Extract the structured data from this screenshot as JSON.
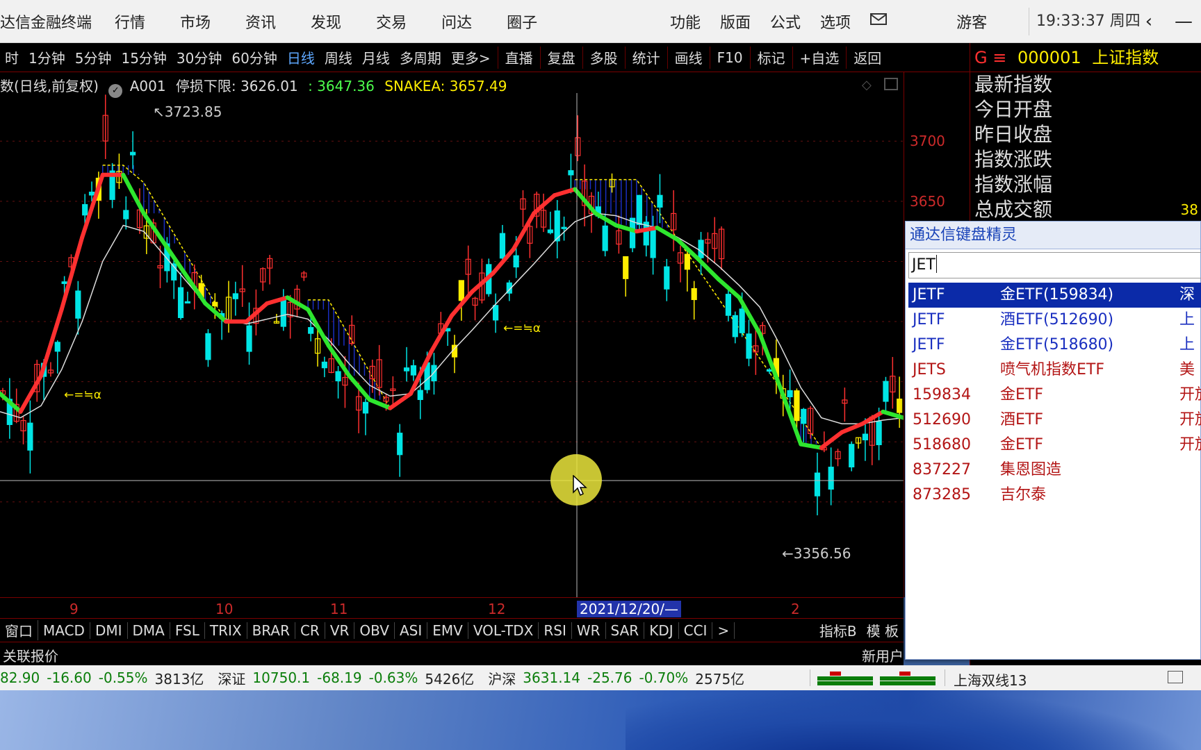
{
  "titlebar": {
    "app_title": "达信金融终端",
    "menus": [
      "行情",
      "市场",
      "资讯",
      "发现",
      "交易",
      "问达",
      "圈子"
    ],
    "right_menus": [
      "功能",
      "版面",
      "公式",
      "选项"
    ],
    "mail_icon": "mail-icon",
    "user": "游客",
    "clock": "19:33:37 周四"
  },
  "toolbar": {
    "items": [
      "时",
      "1分钟",
      "5分钟",
      "15分钟",
      "30分钟",
      "60分钟",
      "日线",
      "周线",
      "月线",
      "多周期",
      "更多>"
    ],
    "active": "日线",
    "right_items": [
      "直播",
      "复盘",
      "多股",
      "统计",
      "画线",
      "F10",
      "标记",
      "+自选",
      "返回"
    ]
  },
  "chart_info": {
    "name": "数(日线,前复权)",
    "a001": "A001",
    "stop_label": "停损下限: 3626.01",
    "v1": ": 3647.36",
    "v2": "SNAKEA: 3657.49"
  },
  "chart_data": {
    "type": "line",
    "title": "",
    "ylabel": "",
    "ylim": [
      3330,
      3740
    ],
    "y_ticks": [
      3650,
      3700
    ],
    "x_ticks": [
      "9",
      "10",
      "11",
      "12",
      "2"
    ],
    "crosshair_date": "2021/12/20/—",
    "high_label": "3723.85",
    "low_label": "3356.56",
    "annotation": "←=≒α",
    "series": [
      {
        "values": [
          3490,
          3475,
          3505,
          3560,
          3620,
          3672,
          3672,
          3640,
          3615,
          3590,
          3565,
          3550,
          3550,
          3565,
          3570,
          3560,
          3530,
          3505,
          3485,
          3478,
          3490,
          3525,
          3555,
          3575,
          3590,
          3610,
          3640,
          3655,
          3660,
          3640,
          3630,
          3625,
          3628,
          3618,
          3602,
          3585,
          3570,
          3540,
          3495,
          3448,
          3445,
          3458,
          3465,
          3475,
          3470
        ]
      },
      {
        "values": [
          3475,
          3470,
          3480,
          3510,
          3550,
          3600,
          3630,
          3625,
          3605,
          3585,
          3565,
          3552,
          3548,
          3552,
          3556,
          3552,
          3535,
          3515,
          3497,
          3488,
          3490,
          3505,
          3525,
          3543,
          3562,
          3580,
          3598,
          3617,
          3633,
          3640,
          3638,
          3632,
          3628,
          3620,
          3610,
          3596,
          3580,
          3562,
          3530,
          3495,
          3470,
          3465,
          3465,
          3468,
          3470
        ]
      }
    ]
  },
  "indicators": {
    "items": [
      "窗口",
      "MACD",
      "DMI",
      "DMA",
      "FSL",
      "TRIX",
      "BRAR",
      "CR",
      "VR",
      "OBV",
      "ASI",
      "EMV",
      "VOL-TDX",
      "RSI",
      "WR",
      "SAR",
      "KDJ",
      "CCI",
      ">"
    ],
    "right": [
      "指标B",
      "模 板"
    ]
  },
  "quotebar": {
    "left": "关联报价",
    "right": "新用户"
  },
  "right_panel": {
    "marker": "G ≡",
    "code": "000001",
    "name": "上证指数",
    "rows": [
      "最新指数",
      "今日开盘",
      "昨日收盘",
      "指数涨跌",
      "指数涨幅",
      "总成交额"
    ],
    "partial_value": "38"
  },
  "statusbar": {
    "sh": {
      "value": "82.90",
      "change": "-16.60",
      "pct": "-0.55%",
      "amount": "3813亿"
    },
    "sz": {
      "label": "深证",
      "value": "10750.1",
      "change": "-68.19",
      "pct": "-0.63%",
      "amount": "5426亿"
    },
    "hs": {
      "label": "沪深",
      "value": "3631.14",
      "change": "-25.76",
      "pct": "-0.70%",
      "amount": "2575亿"
    },
    "line": "上海双线13"
  },
  "wizard": {
    "title": "通达信键盘精灵",
    "input": "JET",
    "items": [
      {
        "code": "JETF",
        "name": "金ETF(159834)",
        "tp": "深",
        "style": "sel"
      },
      {
        "code": "JETF",
        "name": "酒ETF(512690)",
        "tp": "上",
        "style": "blue"
      },
      {
        "code": "JETF",
        "name": "金ETF(518680)",
        "tp": "上",
        "style": "blue"
      },
      {
        "code": "JETS",
        "name": "喷气机指数ETF",
        "tp": "美",
        "style": "red"
      },
      {
        "code": "159834",
        "name": "金ETF",
        "tp": "开放",
        "style": "red"
      },
      {
        "code": "512690",
        "name": "酒ETF",
        "tp": "开放",
        "style": "red"
      },
      {
        "code": "518680",
        "name": "金ETF",
        "tp": "开放",
        "style": "red"
      },
      {
        "code": "837227",
        "name": "集恩图造",
        "tp": "",
        "style": "red"
      },
      {
        "code": "873285",
        "name": "吉尔泰",
        "tp": "",
        "style": "red"
      }
    ]
  },
  "colors": {
    "up": "#ff3030",
    "down": "#00e5e5",
    "trend_up": "#ff3030",
    "trend_down": "#2ee62e",
    "ma": "#dddddd",
    "band": "#1a2fc0",
    "band_edge": "#ffee00"
  }
}
